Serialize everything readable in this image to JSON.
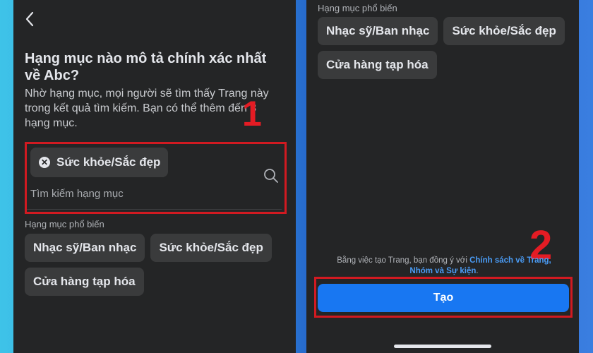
{
  "left": {
    "title": "Hạng mục nào mô tả chính xác nhất về Abc?",
    "description": "Nhờ hạng mục, mọi người sẽ tìm thấy Trang này trong kết quả tìm kiếm. Bạn có thể thêm đến 3 hạng mục.",
    "callout_number": "1",
    "selected_category": "Sức khỏe/Sắc đẹp",
    "search_placeholder": "Tìm kiếm hạng mục",
    "popular_label": "Hạng mục phổ biến",
    "popular_categories": [
      "Nhạc sỹ/Ban nhạc",
      "Sức khỏe/Sắc đẹp",
      "Cửa hàng tạp hóa"
    ]
  },
  "right": {
    "popular_label": "Hạng mục phổ biến",
    "popular_categories": [
      "Nhạc sỹ/Ban nhạc",
      "Sức khỏe/Sắc đẹp",
      "Cửa hàng tạp hóa"
    ],
    "callout_number": "2",
    "terms_prefix": "Bằng việc tạo Trang, bạn đồng ý với ",
    "terms_link": "Chính sách về Trang, Nhóm và Sự kiện",
    "terms_suffix": ".",
    "create_label": "Tạo"
  },
  "colors": {
    "panel_bg": "#242526",
    "chip_bg": "#3a3b3c",
    "accent_blue": "#1877f2",
    "annotation_red": "#e41c24"
  },
  "icons": [
    "chevron-left-icon",
    "remove-icon",
    "search-icon"
  ]
}
